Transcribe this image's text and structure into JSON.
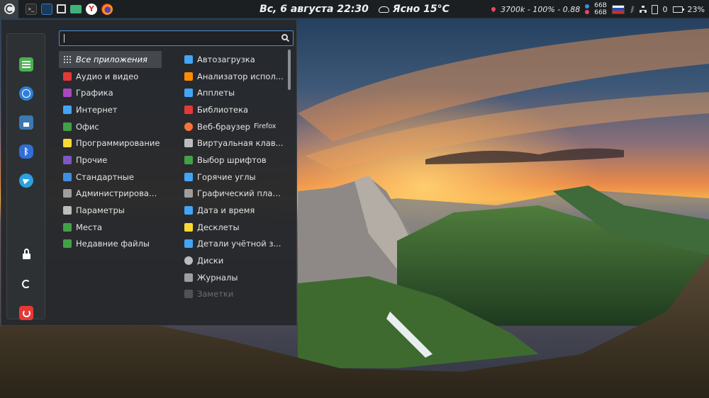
{
  "panel": {
    "clock": "Вс,  6 августа 22:30",
    "weather": "Ясно 15°C",
    "cpu_text": "3700k - 100% - 0.88",
    "mem_top": "66B",
    "mem_bottom": "66B",
    "notifications": "0",
    "battery": "23%",
    "launchers": [
      "terminal-icon",
      "system-monitor-icon",
      "screenshot-icon",
      "file-manager-icon",
      "yandex-browser-icon",
      "firefox-icon"
    ]
  },
  "sidebar": {
    "items": [
      "settings-icon",
      "web-icon",
      "save-icon",
      "bluetooth-icon",
      "telegram-icon",
      "lock-icon",
      "logout-icon",
      "power-icon"
    ]
  },
  "search": {
    "value": "",
    "placeholder": ""
  },
  "categories": [
    {
      "label": "Все приложения",
      "color": "#cccccc",
      "icon": "grid-icon"
    },
    {
      "label": "Аудио и видео",
      "color": "#e53935",
      "icon": "video-icon"
    },
    {
      "label": "Графика",
      "color": "#ab47bc",
      "icon": "graphics-icon"
    },
    {
      "label": "Интернет",
      "color": "#42a5f5",
      "icon": "internet-icon"
    },
    {
      "label": "Офис",
      "color": "#43a047",
      "icon": "office-icon"
    },
    {
      "label": "Программирование",
      "color": "#fdd835",
      "icon": "code-icon"
    },
    {
      "label": "Прочие",
      "color": "#7e57c2",
      "icon": "other-icon"
    },
    {
      "label": "Стандартные",
      "color": "#3f8fe0",
      "icon": "accessories-icon"
    },
    {
      "label": "Администрирован...",
      "color": "#9e9e9e",
      "icon": "admin-icon"
    },
    {
      "label": "Параметры",
      "color": "#bdbdbd",
      "icon": "settings-icon"
    },
    {
      "label": "Места",
      "color": "#43a047",
      "icon": "folder-icon"
    },
    {
      "label": "Недавние файлы",
      "color": "#43a047",
      "icon": "recent-folder-icon"
    }
  ],
  "apps": [
    {
      "label": "Автозагрузка",
      "color": "#42a5f5",
      "icon": "autostart-icon"
    },
    {
      "label": "Анализатор испол...",
      "color": "#fb8c00",
      "icon": "disk-usage-icon"
    },
    {
      "label": "Апплеты",
      "color": "#42a5f5",
      "icon": "applets-icon"
    },
    {
      "label": "Библиотека",
      "color": "#e53935",
      "icon": "library-icon"
    },
    {
      "label": "Веб-браузер",
      "sub": "Firefox",
      "color": "#ff7139",
      "icon": "firefox-icon"
    },
    {
      "label": "Виртуальная клав...",
      "color": "#bdbdbd",
      "icon": "keyboard-icon"
    },
    {
      "label": "Выбор шрифтов",
      "color": "#43a047",
      "icon": "font-icon"
    },
    {
      "label": "Горячие углы",
      "color": "#42a5f5",
      "icon": "hot-corners-icon"
    },
    {
      "label": "Графический план...",
      "color": "#9e9e9e",
      "icon": "scheduler-icon"
    },
    {
      "label": "Дата и время",
      "color": "#42a5f5",
      "icon": "clock-icon"
    },
    {
      "label": "Десклеты",
      "color": "#fdd835",
      "icon": "desklets-icon"
    },
    {
      "label": "Детали учётной з...",
      "color": "#42a5f5",
      "icon": "account-icon"
    },
    {
      "label": "Диски",
      "color": "#bdbdbd",
      "icon": "disks-icon"
    },
    {
      "label": "Журналы",
      "color": "#9e9e9e",
      "icon": "logs-icon"
    },
    {
      "label": "Заметки",
      "color": "#9e9e9e",
      "icon": "notes-icon"
    }
  ],
  "colors": {
    "accent": "#4a90d9",
    "panel": "#1c1f22",
    "menu": "#26282b"
  }
}
